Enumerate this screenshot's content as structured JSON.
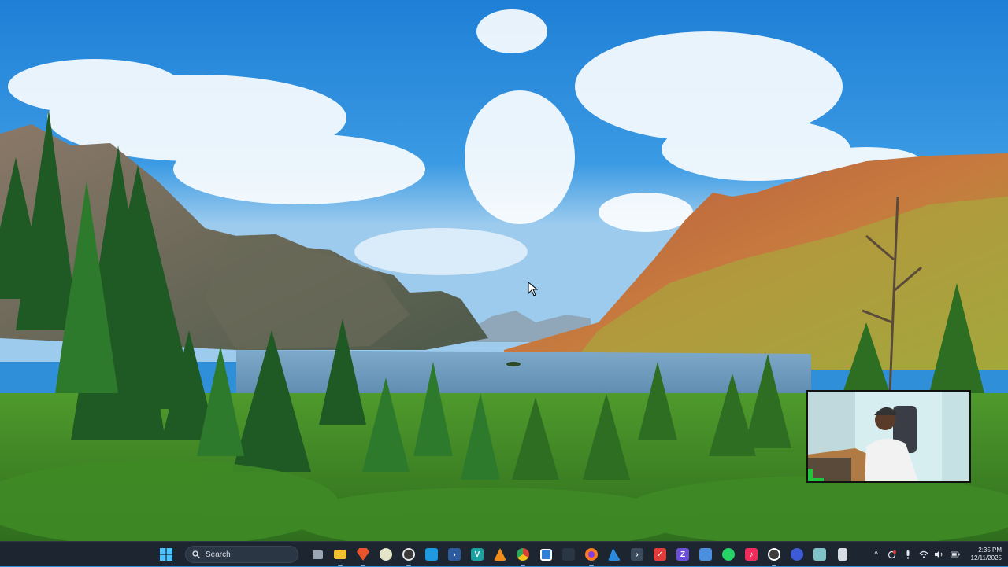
{
  "wallpaper": {
    "subject": "mountain-lake-landscape"
  },
  "webcam": {
    "subject": "presenter-webcam"
  },
  "taskbar": {
    "search_label": "Search",
    "apps": [
      {
        "name": "task-view-icon",
        "color": "#9aa6b4"
      },
      {
        "name": "file-explorer-icon",
        "color": "#f2c12e"
      },
      {
        "name": "brave-icon",
        "color": "#e8552d"
      },
      {
        "name": "media-player-icon",
        "color": "#e4e4c8"
      },
      {
        "name": "obs-icon",
        "color": "#3a3a3a"
      },
      {
        "name": "visual-studio-code-icon",
        "color": "#1e9be0"
      },
      {
        "name": "powershell-icon",
        "color": "#2b5b9e"
      },
      {
        "name": "vs-icon",
        "color": "#1ba1a1"
      },
      {
        "name": "vlc-icon",
        "color": "#f08c1a"
      },
      {
        "name": "chrome-icon",
        "color": "#d94033"
      },
      {
        "name": "store-icon",
        "color": "#2e7fd8"
      },
      {
        "name": "widgets-icon",
        "color": "#2a3644"
      },
      {
        "name": "firefox-icon",
        "color": "#ff7a1a"
      },
      {
        "name": "azure-icon",
        "color": "#2a8ae0"
      },
      {
        "name": "terminal-icon",
        "color": "#3b4a5c"
      },
      {
        "name": "todo-icon",
        "color": "#e03c3c"
      },
      {
        "name": "app-purple-icon",
        "color": "#6c4fd8"
      },
      {
        "name": "calculator-icon",
        "color": "#4a8fe0"
      },
      {
        "name": "whatsapp-icon",
        "color": "#25d366"
      },
      {
        "name": "tiktok-icon",
        "color": "#f02d5a"
      },
      {
        "name": "obs-studio-icon",
        "color": "#3c3c3c"
      },
      {
        "name": "app-blue-icon",
        "color": "#3d5bd6"
      },
      {
        "name": "notepad-icon",
        "color": "#7fc3c8"
      },
      {
        "name": "document-icon",
        "color": "#d8dde4"
      }
    ],
    "clock": {
      "time": "2:35 PM",
      "date": "12/11/2025"
    }
  }
}
